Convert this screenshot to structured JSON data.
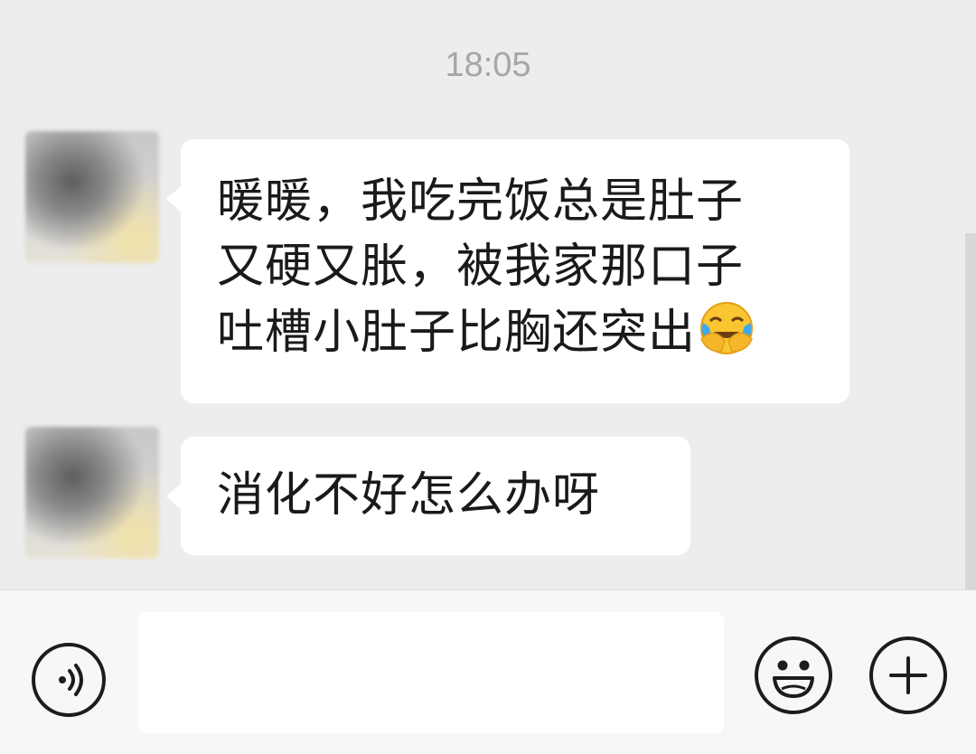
{
  "chat": {
    "timestamp": "18:05",
    "messages": [
      {
        "lines": [
          "暖暖，我吃完饭总是肚子",
          "又硬又胀，被我家那口子",
          "吐槽小肚子比胸还突出"
        ],
        "trailing_emoji": "crying-laughing-emoji"
      },
      {
        "lines": [
          "消化不好怎么办呀"
        ]
      }
    ]
  },
  "input_bar": {
    "text_value": "",
    "icons": [
      "voice-icon",
      "smiley-icon",
      "plus-icon"
    ]
  },
  "colors": {
    "chat_background": "#ededed",
    "bubble": "#ffffff",
    "input_bar": "#f7f7f7",
    "text": "#1a1a1a",
    "timestamp": "#a6a6a6"
  }
}
